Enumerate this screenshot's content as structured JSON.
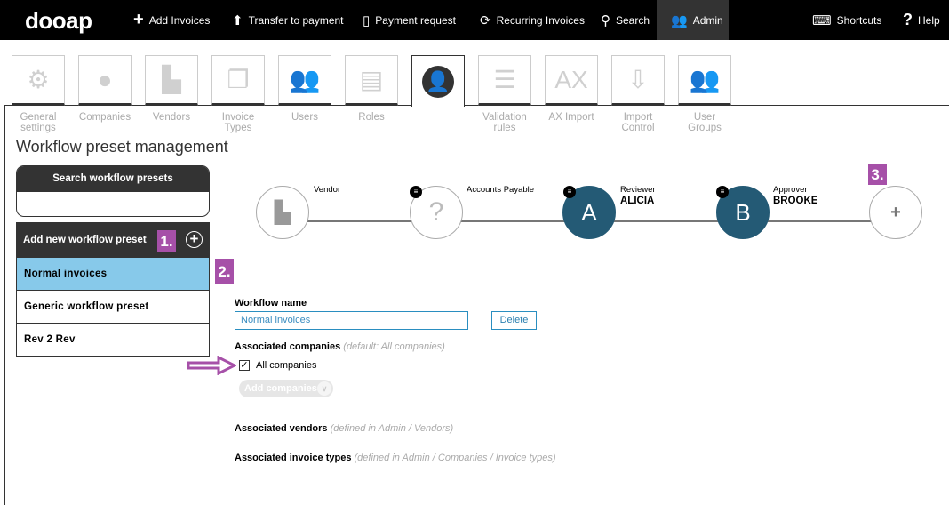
{
  "topbar": {
    "logo": "dooap",
    "items": [
      {
        "label": "Add Invoices",
        "icon": "plus-icon"
      },
      {
        "label": "Transfer to payment",
        "icon": "upload-folder-icon"
      },
      {
        "label": "Payment request",
        "icon": "document-icon"
      },
      {
        "label": "Recurring Invoices",
        "icon": "recurring-calendar-icon"
      },
      {
        "label": "Search",
        "icon": "search-icon"
      },
      {
        "label": "Admin",
        "icon": "users-icon",
        "active": true
      }
    ],
    "shortcuts": "Shortcuts",
    "help": "Help"
  },
  "tabs": [
    {
      "label": "General settings",
      "icon": "gears-icon"
    },
    {
      "label": "Companies",
      "icon": "globe-icon"
    },
    {
      "label": "Vendors",
      "icon": "factory-icon"
    },
    {
      "label": "Invoice Types",
      "icon": "documents-icon"
    },
    {
      "label": "Users",
      "icon": "users-icon"
    },
    {
      "label": "Roles",
      "icon": "id-card-icon"
    },
    {
      "label": "",
      "icon": "workflow-user-icon",
      "active": true
    },
    {
      "label": "Validation rules",
      "icon": "checklist-icon"
    },
    {
      "label": "AX Import",
      "icon": "ax-icon"
    },
    {
      "label": "Import Control",
      "icon": "import-icon"
    },
    {
      "label": "User Groups",
      "icon": "user-group-icon"
    }
  ],
  "page_title": "Workflow preset management",
  "sidebar": {
    "search_label": "Search workflow presets",
    "search_value": "",
    "add_label": "Add new workflow preset",
    "items": [
      "Normal invoices",
      "Generic workflow preset",
      "Rev 2 Rev"
    ],
    "selected": "Normal invoices"
  },
  "annotations": {
    "one": "1.",
    "two": "2.",
    "three": "3."
  },
  "workflow": {
    "steps": [
      {
        "role": "Vendor",
        "name": "",
        "icon": "factory-icon"
      },
      {
        "role": "Accounts Payable",
        "name": "",
        "icon": "unknown-person-icon"
      },
      {
        "role": "Reviewer",
        "name": "ALICIA",
        "initial": "A"
      },
      {
        "role": "Approver",
        "name": "BROOKE",
        "initial": "B"
      }
    ],
    "add_step": "+",
    "step_color": "#245a75"
  },
  "form": {
    "workflow_name_label": "Workflow name",
    "workflow_name_value": "Normal invoices",
    "delete_label": "Delete",
    "companies_label": "Associated companies",
    "companies_hint": "(default: All companies)",
    "all_companies_label": "All companies",
    "all_companies_checked": true,
    "add_companies": "Add companies",
    "vendors_label": "Associated vendors",
    "vendors_hint": "(defined in Admin / Vendors)",
    "types_label": "Associated invoice types",
    "types_hint": "(defined in Admin / Companies / Invoice types)"
  },
  "colors": {
    "selected_row": "#87c9ea",
    "annotation": "#a650a8",
    "accent": "#2a8ec0"
  }
}
